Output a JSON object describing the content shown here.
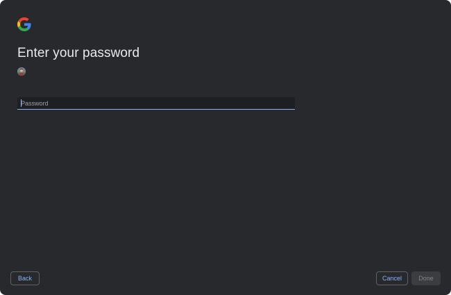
{
  "header": {
    "logo_icon": "google-g-icon",
    "title": "Enter your password"
  },
  "account": {
    "avatar_icon": "account-avatar"
  },
  "password_field": {
    "placeholder": "Password",
    "value": ""
  },
  "footer": {
    "back_label": "Back",
    "cancel_label": "Cancel",
    "done_label": "Done"
  },
  "colors": {
    "background": "#28292c",
    "accent": "#8ab4f8",
    "title_text": "#e8eaed",
    "field_background": "#1e1f22",
    "disabled_button": "#3c3d40"
  }
}
